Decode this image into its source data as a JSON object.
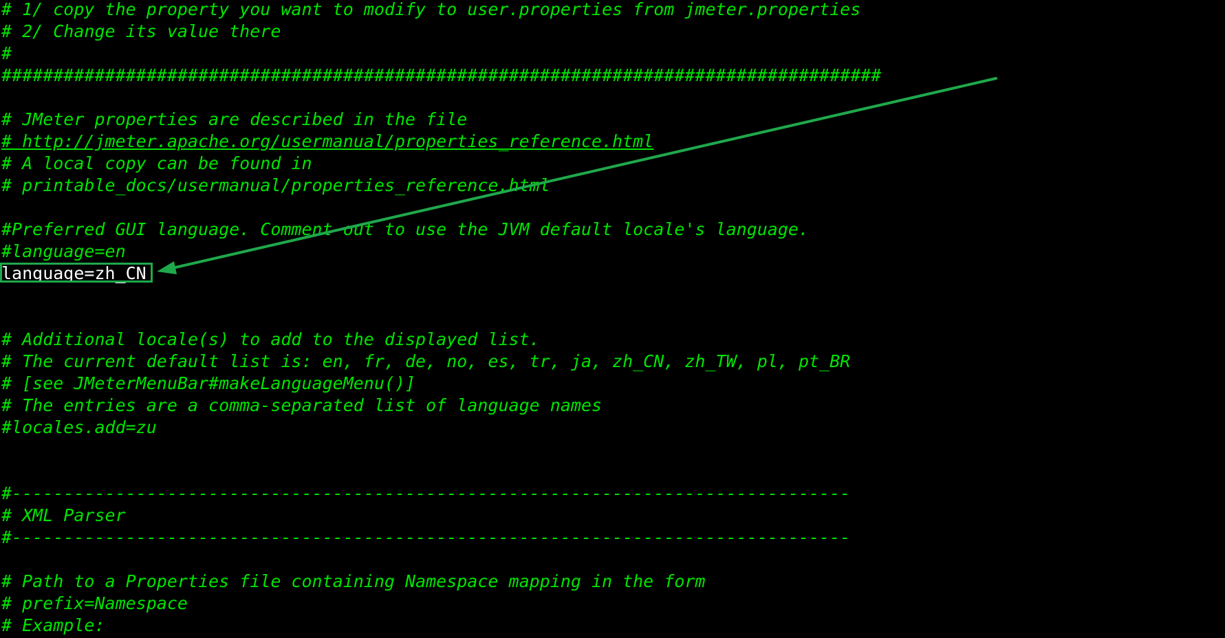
{
  "editor": {
    "lines": [
      "# 1/ copy the property you want to modify to user.properties from jmeter.properties",
      "# 2/ Change its value there",
      "#",
      "#####################################################################################",
      "",
      "# JMeter properties are described in the file",
      "# http://jmeter.apache.org/usermanual/properties_reference.html",
      "# A local copy can be found in",
      "# printable_docs/usermanual/properties_reference.html",
      "",
      "#Preferred GUI language. Comment out to use the JVM default locale's language.",
      "#language=en",
      "language=zh_CN",
      "",
      "",
      "# Additional locale(s) to add to the displayed list.",
      "# The current default list is: en, fr, de, no, es, tr, ja, zh_CN, zh_TW, pl, pt_BR",
      "# [see JMeterMenuBar#makeLanguageMenu()]",
      "# The entries are a comma-separated list of language names",
      "#locales.add=zu",
      "",
      "",
      "#---------------------------------------------------------------------------------",
      "# XML Parser",
      "#---------------------------------------------------------------------------------",
      "",
      "# Path to a Properties file containing Namespace mapping in the form",
      "# prefix=Namespace",
      "# Example:"
    ]
  },
  "colors": {
    "background": "#000000",
    "text": "#00e400",
    "highlight_text": "#ffffff",
    "annotation": "#1fa84b"
  }
}
